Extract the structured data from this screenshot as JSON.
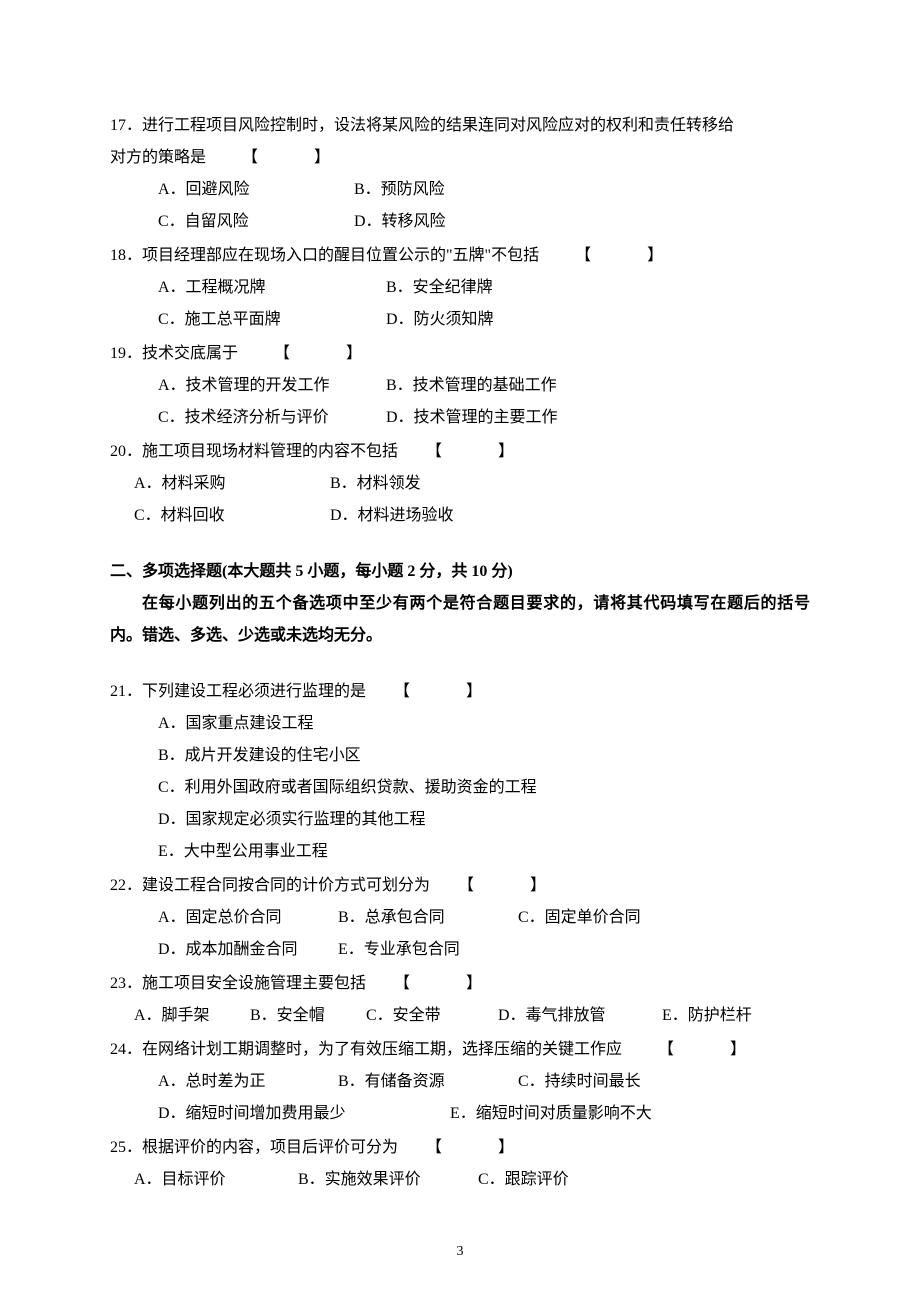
{
  "q17": {
    "stem_line1": "17．进行工程项目风险控制时，设法将某风险的结果连同对风险应对的权利和责任转移给",
    "stem_line2": "对方的策略是",
    "bracket": "【　　】",
    "optA": "A．回避风险",
    "optB": "B．预防风险",
    "optC": "C．自留风险",
    "optD": "D．转移风险"
  },
  "q18": {
    "stem": "18．项目经理部应在现场入口的醒目位置公示的\"五牌\"不包括",
    "bracket": "【　　】",
    "optA": "A．工程概况牌",
    "optB": "B．安全纪律牌",
    "optC": "C．施工总平面牌",
    "optD": "D．防火须知牌"
  },
  "q19": {
    "stem": "19．技术交底属于",
    "bracket": "【　　】",
    "optA": "A．技术管理的开发工作",
    "optB": "B．技术管理的基础工作",
    "optC": "C．技术经济分析与评价",
    "optD": "D．技术管理的主要工作"
  },
  "q20": {
    "stem": "20．施工项目现场材料管理的内容不包括",
    "bracket": "【　　】",
    "optA": "A．材料采购",
    "optB": "B．材料领发",
    "optC": "C．材料回收",
    "optD": "D．材料进场验收"
  },
  "section2": {
    "title": "二、多项选择题(本大题共 5 小题，每小题 2 分，共 10 分)",
    "instr": "在每小题列出的五个备选项中至少有两个是符合题目要求的，请将其代码填写在题后的括号内。错选、多选、少选或未选均无分。"
  },
  "q21": {
    "stem": "21．下列建设工程必须进行监理的是",
    "bracket": "【　　】",
    "optA": "A．国家重点建设工程",
    "optB": "B．成片开发建设的住宅小区",
    "optC": "C．利用外国政府或者国际组织贷款、援助资金的工程",
    "optD": "D．国家规定必须实行监理的其他工程",
    "optE": "E．大中型公用事业工程"
  },
  "q22": {
    "stem": "22．建设工程合同按合同的计价方式可划分为",
    "bracket": "【　　】",
    "optA": "A．固定总价合同",
    "optB": "B．总承包合同",
    "optC": "C．固定单价合同",
    "optD": "D．成本加酬金合同",
    "optE": "E．专业承包合同"
  },
  "q23": {
    "stem": "23．施工项目安全设施管理主要包括",
    "bracket": "【　　】",
    "optA": "A．脚手架",
    "optB": "B．安全帽",
    "optC": "C．安全带",
    "optD": "D．毒气排放管",
    "optE": "E．防护栏杆"
  },
  "q24": {
    "stem": "24．在网络计划工期调整时，为了有效压缩工期，选择压缩的关键工作应",
    "bracket": "【　　】",
    "optA": "A．总时差为正",
    "optB": "B．有储备资源",
    "optC": "C．持续时间最长",
    "optD": "D．缩短时间增加费用最少",
    "optE": "E．缩短时间对质量影响不大"
  },
  "q25": {
    "stem": "25．根据评价的内容，项目后评价可分为",
    "bracket": "【　　】",
    "optA": "A．目标评价",
    "optB": "B．实施效果评价",
    "optC": "C．跟踪评价"
  },
  "page_number": "3"
}
